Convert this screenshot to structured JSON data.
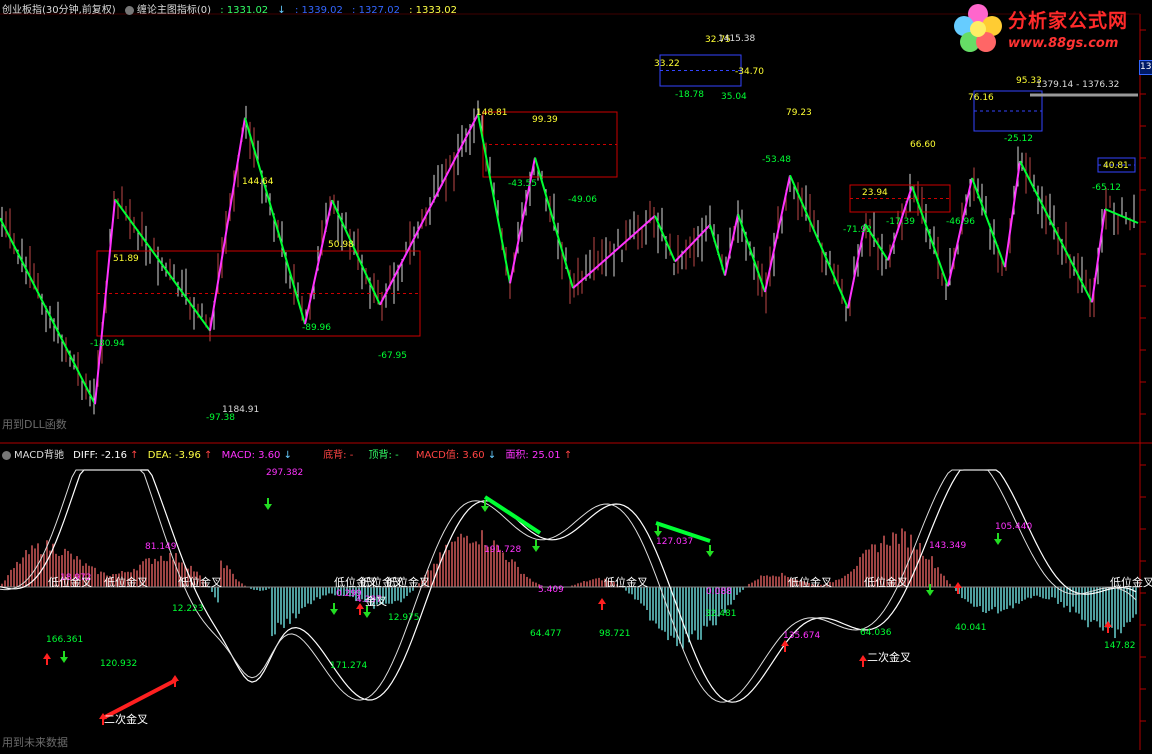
{
  "top_header": {
    "title": "创业板指(30分钟,前复权)",
    "indicator": "缠论主图指标(0)",
    "v1": ": 1331.02",
    "v2": ": 1339.02",
    "v3": ": 1327.02",
    "v4": ": 1333.02"
  },
  "bottom_header": {
    "name": "MACD背驰",
    "diff": "DIFF: -2.16",
    "dea": "DEA: -3.96",
    "macd": "MACD: 3.60",
    "dibei": "底背: -",
    "dingbei": "顶背: -",
    "macdzhi": "MACD值: 3.60",
    "mianji": "面积: 25.01"
  },
  "notes": {
    "dll": "用到DLL函数",
    "future": "用到未来数据"
  },
  "logo": {
    "title": "分析家公式网",
    "url": "www.88gs.com"
  },
  "right_tag": "13",
  "colors": {
    "up": "#e05555",
    "down": "#2ad0ff",
    "green": "#00ff33",
    "magenta": "#ff33ff",
    "yellow": "#ffff33",
    "white": "#ffffff"
  },
  "chart_data": [
    {
      "type": "line",
      "panel": "price",
      "series": [
        {
          "name": "zigzag",
          "x": [
            0,
            95,
            115,
            210,
            245,
            305,
            332,
            380,
            478,
            510,
            535,
            573,
            655,
            675,
            710,
            725,
            738,
            765,
            790,
            848,
            865,
            888,
            912,
            948,
            972,
            1005,
            1020,
            1092,
            1105,
            1138
          ],
          "y": [
            30.5,
            -180.94,
            51.89,
            -97.38,
            144.64,
            -89.96,
            50.98,
            -67.95,
            148.81,
            -43.55,
            99.39,
            -49.06,
            33.22,
            -18.78,
            22.75,
            -34.7,
            35.04,
            -53.48,
            79.23,
            -71.92,
            23.94,
            -17.39,
            66.6,
            -46.96,
            76.16,
            -25.12,
            95.33,
            -65.12,
            40.81,
            25.0
          ]
        }
      ],
      "annotations": [
        "51.89",
        "-180.94",
        "144.64",
        "-97.38",
        "1184.91",
        "50.98",
        "-89.96",
        "-67.95",
        "148.81",
        "99.39",
        "-43.55",
        "-49.06",
        "33.22",
        "32.75",
        "1415.38",
        "-18.78",
        "35.04",
        "-34.70",
        "79.23",
        "-53.48",
        "23.94",
        "-71.92",
        "-17.39",
        "66.60",
        "-46.96",
        "76.16",
        "95.33",
        "1379.14 - 1376.32",
        "-25.12",
        "40.81",
        "-65.12"
      ]
    },
    {
      "type": "bar",
      "panel": "macd",
      "series": [
        {
          "name": "DIFF"
        },
        {
          "name": "DEA"
        },
        {
          "name": "MACD"
        }
      ],
      "annotations": [
        "18.972",
        "81.149",
        "12.223",
        "166.361",
        "120.932",
        "297.382",
        "171.274",
        "0.299",
        "4.297",
        "12.975",
        "191.728",
        "5.409",
        "64.477",
        "98.721",
        "127.037",
        "0.088",
        "32.481",
        "135.674",
        "64.036",
        "143.349",
        "105.440",
        "40.041",
        "147.82"
      ],
      "event_labels": [
        "低位金叉",
        "低位金叉",
        "低位金叉",
        "低位金叉",
        "低位金叉",
        "低位金叉",
        "低位金叉",
        "低位金叉",
        "低位金叉",
        "低位金叉",
        "金叉",
        "二次金叉",
        "二次金叉"
      ]
    }
  ]
}
